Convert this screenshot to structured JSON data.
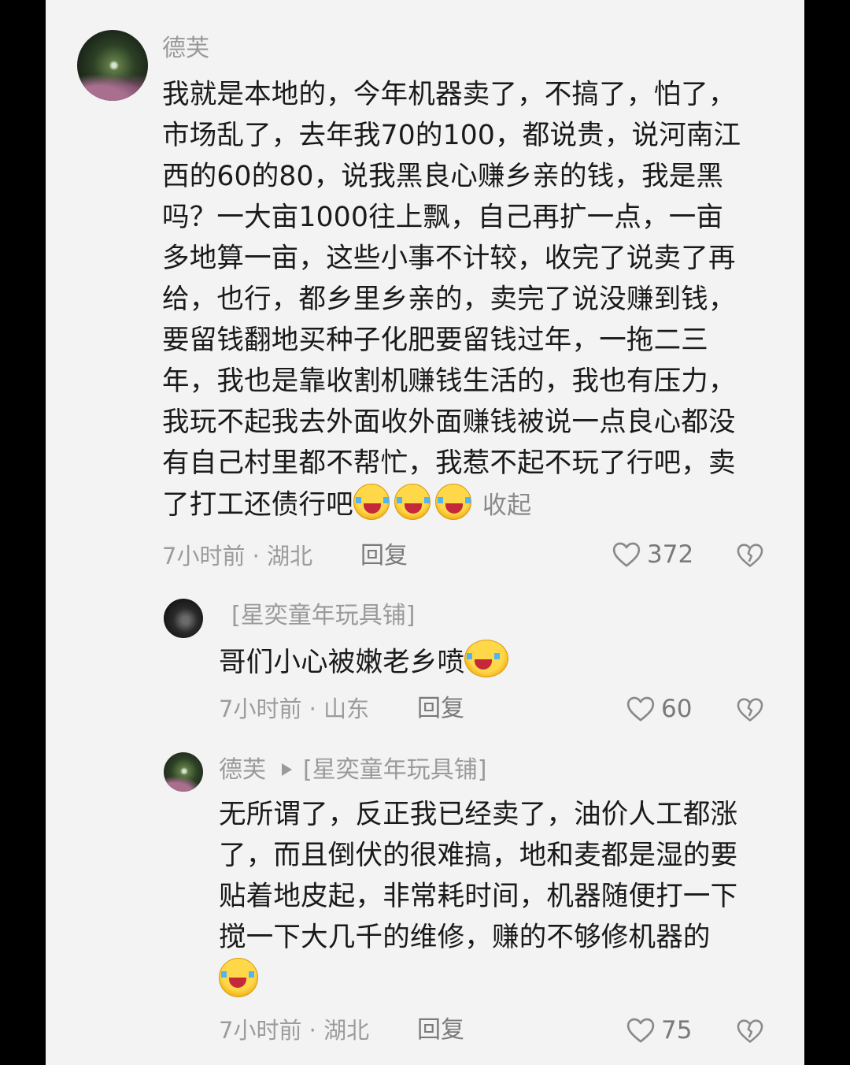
{
  "comment": {
    "username": "德芙",
    "lines": [
      "我就是本地的，今年机器卖了，不搞了，怕了，",
      "市场乱了，去年我70的100，都说贵，说河南江",
      "西的60的80，说我黑良心赚乡亲的钱，我是黑",
      "吗？一大亩1000往上飘，自己再扩一点，一亩",
      "多地算一亩，这些小事不计较，收完了说卖了再",
      "给，也行，都乡里乡亲的，卖完了说没赚到钱，",
      "要留钱翻地买种子化肥要留钱过年，一拖二三",
      "年，我也是靠收割机赚钱生活的，我也有压力，",
      "我玩不起我去外面收外面赚钱被说一点良心都没",
      "有自己村里都不帮忙，我惹不起不玩了行吧，卖",
      "了打工还债行吧"
    ],
    "emoji_icon": "crying-laughing-emoji",
    "collapse_label": "收起",
    "time": "7小时前",
    "location": "湖北",
    "reply_label": "回复",
    "likes": "372"
  },
  "replies": [
    {
      "username": "[星奕童年玩具铺]",
      "lines": [
        "哥们小心被嫩老乡喷"
      ],
      "emoji_icon": "laughing-tears-emoji",
      "time": "7小时前",
      "location": "山东",
      "reply_label": "回复",
      "likes": "60"
    },
    {
      "username": "德芙",
      "reply_to": "[星奕童年玩具铺]",
      "lines": [
        "无所谓了，反正我已经卖了，油价人工都涨",
        "了，而且倒伏的很难搞，地和麦都是湿的要",
        "贴着地皮起，非常耗时间，机器随便打一下",
        "搅一下大几千的维修，赚的不够修机器的"
      ],
      "emoji_icon": "crying-laughing-emoji",
      "time": "7小时前",
      "location": "湖北",
      "reply_label": "回复",
      "likes": "75"
    }
  ],
  "meta_separator": " · ",
  "icons": {
    "like": "heart-outline-icon",
    "dislike": "broken-heart-icon"
  },
  "colors": {
    "background": "#f3f3f3",
    "text": "#1a1a1a",
    "secondary": "#9c9c9c",
    "outer": "#000000"
  }
}
